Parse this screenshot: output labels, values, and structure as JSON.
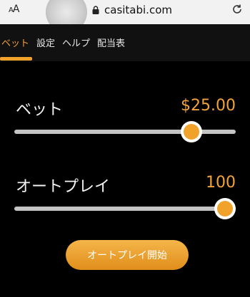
{
  "browser": {
    "text_size_label": "AA",
    "url": "casitabi.com"
  },
  "tabs": [
    {
      "label": "ベット",
      "active": true
    },
    {
      "label": "設定",
      "active": false
    },
    {
      "label": "ヘルプ",
      "active": false
    },
    {
      "label": "配当表",
      "active": false
    }
  ],
  "bet": {
    "label": "ベット",
    "value": "$25.00",
    "slider_fraction": 0.8
  },
  "autoplay": {
    "label": "オートプレイ",
    "value": "100",
    "slider_fraction": 0.95
  },
  "start_button_label": "オートプレイ開始",
  "colors": {
    "accent": "#f2a23b",
    "background": "#000000",
    "tab_bar": "#111111"
  }
}
